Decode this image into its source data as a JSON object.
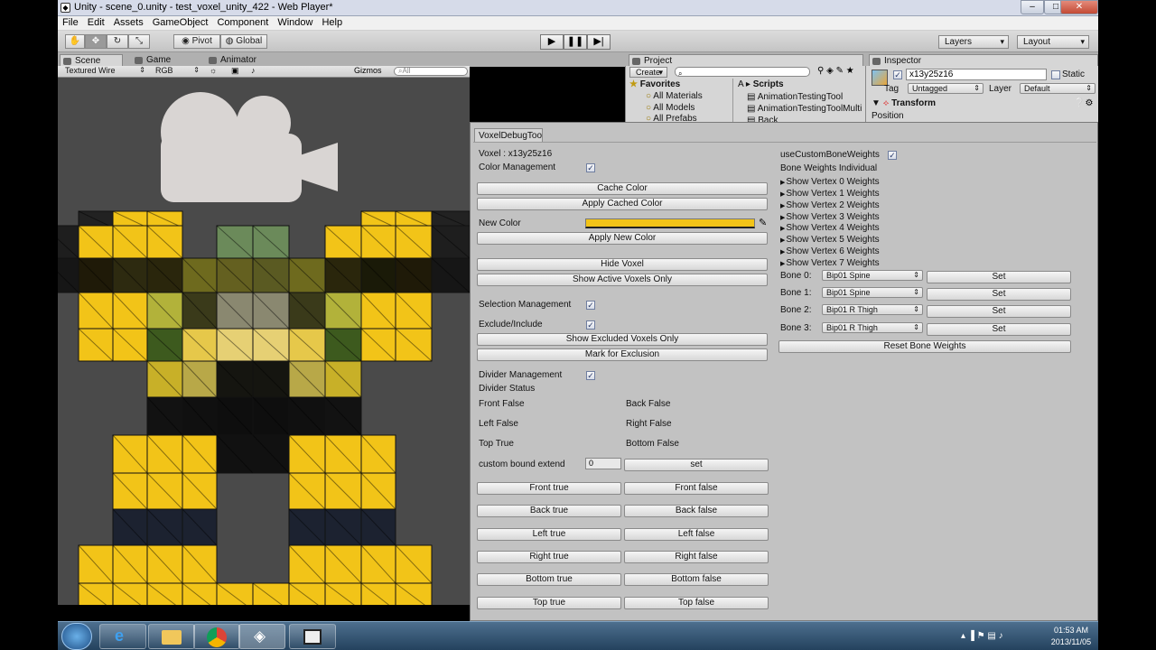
{
  "window": {
    "title": "Unity - scene_0.unity - test_voxel_unity_422 - Web Player*"
  },
  "menu": [
    "File",
    "Edit",
    "Assets",
    "GameObject",
    "Component",
    "Window",
    "Help"
  ],
  "toolbar": {
    "pivot": "Pivot",
    "global": "Global",
    "layers": "Layers",
    "layout": "Layout"
  },
  "tabs": {
    "scene": "Scene",
    "game": "Game",
    "animator": "Animator",
    "project": "Project",
    "inspector": "Inspector"
  },
  "scene_toolbar": {
    "render_mode": "Textured Wire",
    "color_mode": "RGB",
    "gizmos": "Gizmos",
    "search_placeholder": "All"
  },
  "project": {
    "create": "Create",
    "favorites": "Favorites",
    "fav_items": [
      "All Materials",
      "All Models",
      "All Prefabs"
    ],
    "breadcrumb": "A",
    "folder": "Scripts",
    "files": [
      "AnimationTestingTool",
      "AnimationTestingToolMulti",
      "Back"
    ]
  },
  "inspector": {
    "object_name": "x13y25z16",
    "static_label": "Static",
    "tag_label": "Tag",
    "tag_value": "Untagged",
    "layer_label": "Layer",
    "layer_value": "Default",
    "component": "Transform",
    "position": "Position"
  },
  "debug": {
    "tab": "VoxelDebugTool",
    "voxel": "Voxel : x13y25z16",
    "color_mgmt": "Color Management",
    "cache_color": "Cache Color",
    "apply_cached": "Apply Cached Color",
    "new_color": "New Color",
    "new_color_hex": "#f2c418",
    "apply_new": "Apply New Color",
    "hide_voxel": "Hide Voxel",
    "show_active": "Show Active Voxels Only",
    "selection_mgmt": "Selection Management",
    "exclude_include": "Exclude/Include",
    "show_excluded": "Show Excluded Voxels Only",
    "mark_exclusion": "Mark for Exclusion",
    "divider_mgmt": "Divider Management",
    "divider_status": "Divider Status",
    "status": {
      "front": "Front False",
      "back": "Back False",
      "left": "Left False",
      "right": "Right False",
      "top": "Top True",
      "bottom": "Bottom False"
    },
    "custom_bound": "custom bound extend",
    "custom_bound_value": "0",
    "set": "set",
    "dir_buttons": [
      [
        "Front true",
        "Front false"
      ],
      [
        "Back true",
        "Back false"
      ],
      [
        "Left true",
        "Left false"
      ],
      [
        "Right true",
        "Right false"
      ],
      [
        "Bottom true",
        "Bottom false"
      ],
      [
        "Top true",
        "Top false"
      ]
    ],
    "use_custom": "useCustomBoneWeights",
    "bone_weights_individual": "Bone Weights Individual",
    "vertex": [
      "Show Vertex 0 Weights",
      "Show Vertex 1 Weights",
      "Show Vertex 2 Weights",
      "Show Vertex 3 Weights",
      "Show Vertex 4 Weights",
      "Show Vertex 5 Weights",
      "Show Vertex 6 Weights",
      "Show Vertex 7 Weights"
    ],
    "bones": [
      {
        "label": "Bone 0:",
        "value": "Bip01 Spine",
        "btn": "Set"
      },
      {
        "label": "Bone 1:",
        "value": "Bip01 Spine",
        "btn": "Set"
      },
      {
        "label": "Bone 2:",
        "value": "Bip01 R Thigh",
        "btn": "Set"
      },
      {
        "label": "Bone 3:",
        "value": "Bip01 R Thigh",
        "btn": "Set"
      }
    ],
    "reset_bone": "Reset Bone Weights"
  },
  "taskbar": {
    "time": "01:53 AM",
    "date": "2013/11/05"
  },
  "colors": {
    "yellow": "#f2c418",
    "accent": "#3a5a8a"
  }
}
